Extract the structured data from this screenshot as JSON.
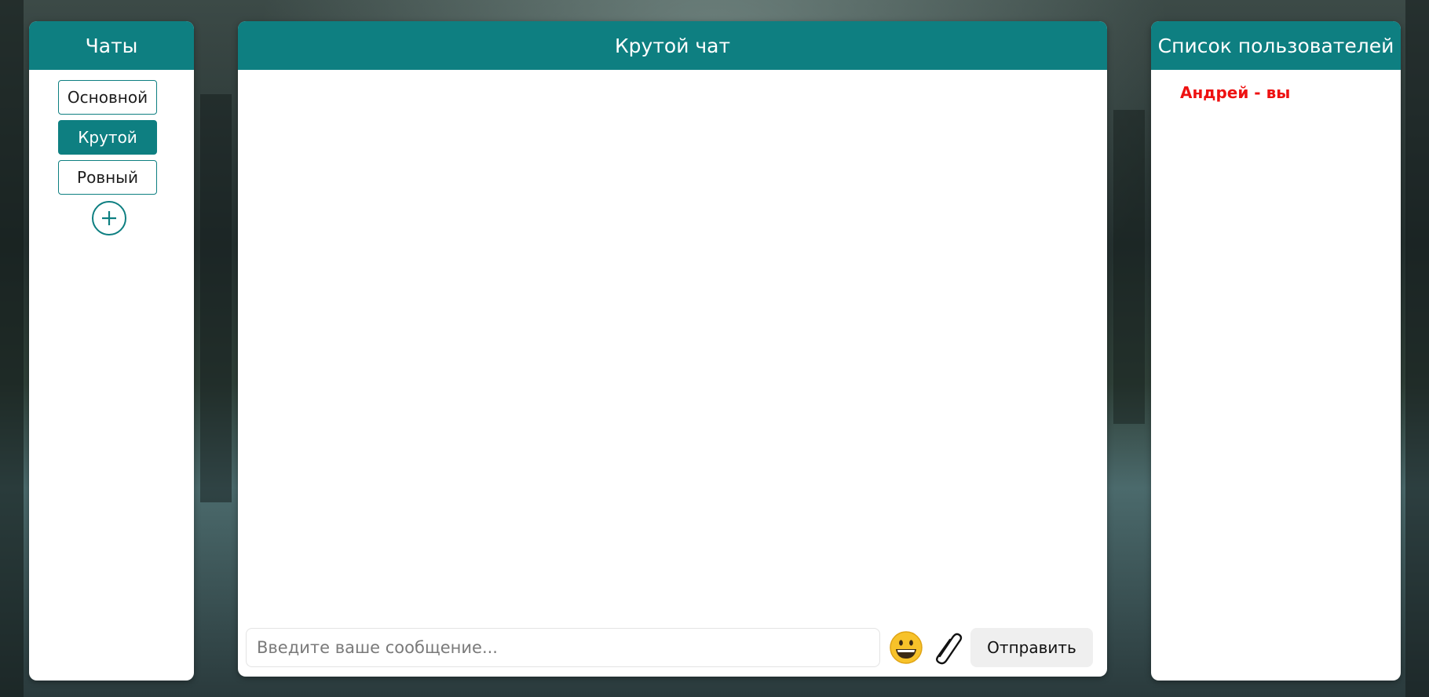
{
  "chats_panel": {
    "title": "Чаты",
    "items": [
      {
        "label": "Основной",
        "active": false
      },
      {
        "label": "Крутой",
        "active": true
      },
      {
        "label": "Ровный",
        "active": false
      }
    ],
    "add_icon": "plus-circle-icon"
  },
  "chat_panel": {
    "title": "Крутой чат",
    "input": {
      "value": "",
      "placeholder": "Введите ваше сообщение..."
    },
    "emoji_icon": "grinning-face-icon",
    "attach_icon": "paperclip-icon",
    "send_label": "Отправить"
  },
  "users_panel": {
    "title": "Список пользователей",
    "users": [
      {
        "label": "Андрей - вы",
        "color": "#ee1111"
      }
    ]
  },
  "colors": {
    "accent": "#0e7f81",
    "self_user": "#ee1111"
  }
}
